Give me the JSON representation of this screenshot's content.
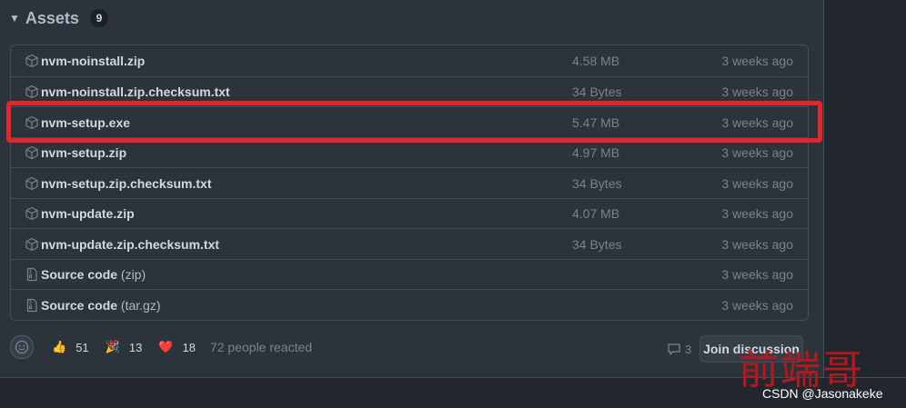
{
  "assets": {
    "title": "Assets",
    "count": "9",
    "rows": [
      {
        "name": "nvm-noinstall.zip",
        "suffix": "",
        "size": "4.58 MB",
        "time": "3 weeks ago",
        "icon": "package-icon"
      },
      {
        "name": "nvm-noinstall.zip.checksum.txt",
        "suffix": "",
        "size": "34 Bytes",
        "time": "3 weeks ago",
        "icon": "package-icon"
      },
      {
        "name": "nvm-setup.exe",
        "suffix": "",
        "size": "5.47 MB",
        "time": "3 weeks ago",
        "icon": "package-icon"
      },
      {
        "name": "nvm-setup.zip",
        "suffix": "",
        "size": "4.97 MB",
        "time": "3 weeks ago",
        "icon": "package-icon"
      },
      {
        "name": "nvm-setup.zip.checksum.txt",
        "suffix": "",
        "size": "34 Bytes",
        "time": "3 weeks ago",
        "icon": "package-icon"
      },
      {
        "name": "nvm-update.zip",
        "suffix": "",
        "size": "4.07 MB",
        "time": "3 weeks ago",
        "icon": "package-icon"
      },
      {
        "name": "nvm-update.zip.checksum.txt",
        "suffix": "",
        "size": "34 Bytes",
        "time": "3 weeks ago",
        "icon": "package-icon"
      },
      {
        "name": "Source code",
        "suffix": " (zip)",
        "size": "",
        "time": "3 weeks ago",
        "icon": "file-zip-icon"
      },
      {
        "name": "Source code",
        "suffix": " (tar.gz)",
        "size": "",
        "time": "3 weeks ago",
        "icon": "file-zip-icon"
      }
    ]
  },
  "reactions": {
    "items": [
      {
        "emoji": "👍",
        "count": "51"
      },
      {
        "emoji": "🎉",
        "count": "13"
      },
      {
        "emoji": "❤️",
        "count": "18"
      }
    ],
    "summary": "72 people reacted"
  },
  "discussion": {
    "comment_count": "3",
    "join_label": "Join discussion"
  },
  "watermark": {
    "cn": "前端哥",
    "csdn": "CSDN @Jasonakeke"
  },
  "colors": {
    "highlight": "#e3262a",
    "background": "#2d333b"
  }
}
